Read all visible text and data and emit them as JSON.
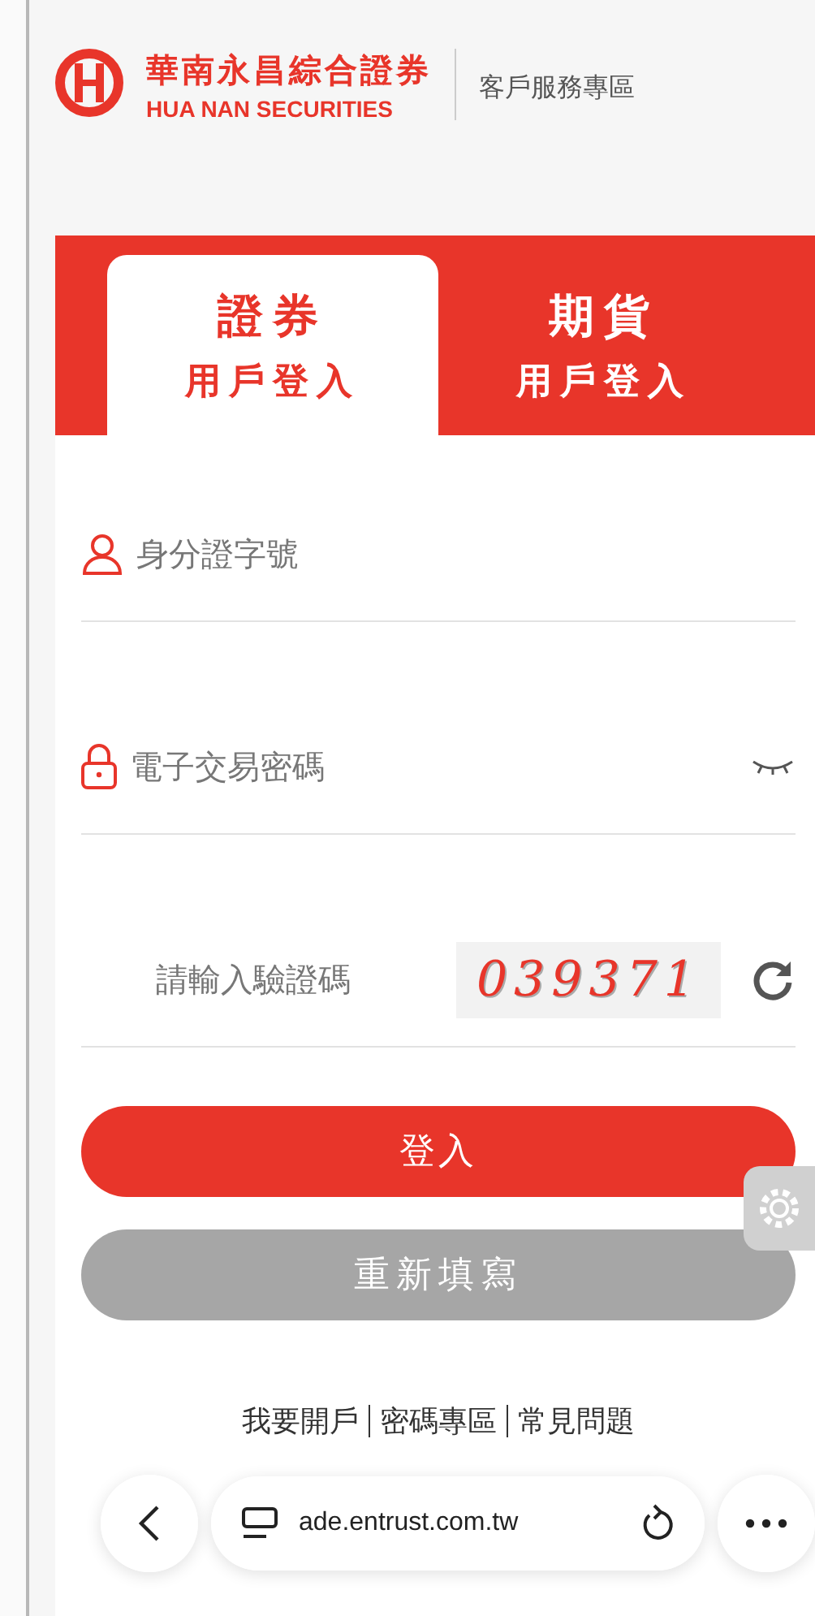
{
  "header": {
    "brand_name": "華南永昌綜合證券",
    "brand_english": "HUA NAN SECURITIES",
    "section": "客戶服務專區"
  },
  "tabs": [
    {
      "title": "證券",
      "subtitle": "用戶登入",
      "selected": true
    },
    {
      "title": "期貨",
      "subtitle": "用戶登入",
      "selected": false
    }
  ],
  "form": {
    "fields": [
      {
        "kind": "id",
        "placeholder": "身分證字號"
      },
      {
        "kind": "password",
        "placeholder": "電子交易密碼"
      },
      {
        "kind": "captcha",
        "placeholder": "請輸入驗證碼",
        "code": "039371"
      }
    ],
    "buttons": [
      {
        "kind": "primary",
        "label": "登入"
      },
      {
        "kind": "secondary",
        "label": "重新填寫"
      }
    ],
    "links": [
      "我要開戶",
      "密碼專區",
      "常見問題"
    ]
  },
  "browser_bar": {
    "url": "ade.entrust.com.tw"
  }
}
